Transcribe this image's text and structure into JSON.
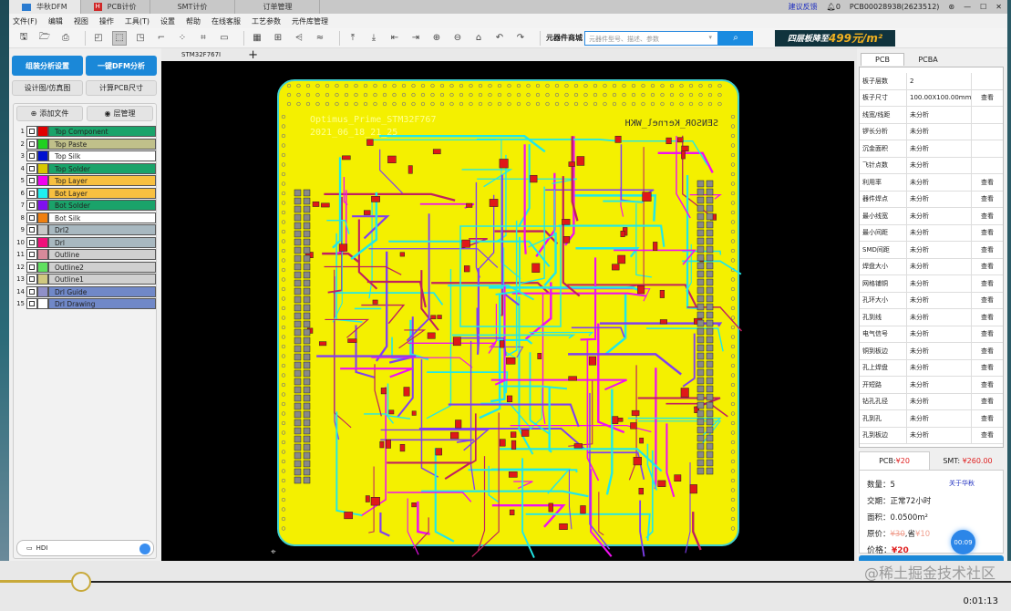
{
  "window": {
    "tabs": [
      {
        "label": "华秋DFM",
        "icon": "app-icon"
      },
      {
        "label": "PCB计价",
        "icon": "h-icon"
      },
      {
        "label": "SMT计价"
      },
      {
        "label": "订单管理"
      }
    ],
    "feedback": "建议反馈",
    "notifications": "0",
    "account": "PCB00028938(2623512)"
  },
  "menu": [
    "文件(F)",
    "编辑",
    "视图",
    "操作",
    "工具(T)",
    "设置",
    "帮助",
    "在线客服",
    "工艺参数",
    "元件库管理"
  ],
  "toolbar": {
    "icons": [
      "save-icon",
      "open-icon",
      "print-icon",
      "|",
      "window-icon",
      "select-icon",
      "zoom-box-icon",
      "route-icon",
      "nodes-icon",
      "net-icon",
      "line-icon",
      "|",
      "grid-icon",
      "align-icon",
      "measure-icon",
      "wave-icon",
      "|",
      "top-align-icon",
      "bottom-align-icon",
      "left-align-icon",
      "right-align-icon",
      "zoom-in-icon",
      "zoom-out-icon",
      "home-icon",
      "undo-icon",
      "redo-icon"
    ],
    "shop_label": "元器件商城",
    "search_placeholder": "元器件型号、描述、参数",
    "banner_text": "四层板降至",
    "banner_price": "499元/m²"
  },
  "file_tab": "STM32F767I",
  "left": {
    "btn_assembly": "组装分析设置",
    "btn_dfm": "一键DFM分析",
    "btn_design": "设计图/仿真图",
    "btn_calc": "计算PCB尺寸",
    "btn_add": "添加文件",
    "btn_layers": "层管理",
    "layers": [
      {
        "n": "1",
        "name": "Top Component",
        "swatch": "#e00000",
        "bg": "#1aa36a"
      },
      {
        "n": "2",
        "name": "Top Paste",
        "swatch": "#20d020",
        "bg": "#c0c08a"
      },
      {
        "n": "3",
        "name": "Top Silk",
        "swatch": "#0010d0",
        "bg": "#ffffff"
      },
      {
        "n": "4",
        "name": "Top Solder",
        "swatch": "#d8c800",
        "bg": "#1aa36a"
      },
      {
        "n": "5",
        "name": "Top Layer",
        "swatch": "#f000f0",
        "bg": "#f8c040"
      },
      {
        "n": "6",
        "name": "Bot Layer",
        "swatch": "#20f0f0",
        "bg": "#f8c040"
      },
      {
        "n": "7",
        "name": "Bot Solder",
        "swatch": "#8010f0",
        "bg": "#1aa36a"
      },
      {
        "n": "8",
        "name": "Bot Silk",
        "swatch": "#f08010",
        "bg": "#ffffff"
      },
      {
        "n": "9",
        "name": "Drl2",
        "swatch": "#c8c8c8",
        "bg": "#a8b8c0"
      },
      {
        "n": "10",
        "name": "Drl",
        "swatch": "#f0107a",
        "bg": "#a8b8c0"
      },
      {
        "n": "11",
        "name": "Outline",
        "swatch": "#d88a9a",
        "bg": "#d0d0d0"
      },
      {
        "n": "12",
        "name": "Outline2",
        "swatch": "#60e060",
        "bg": "#d0d0d0"
      },
      {
        "n": "13",
        "name": "Outline1",
        "swatch": "#d0c880",
        "bg": "#d0d0d0"
      },
      {
        "n": "14",
        "name": "Drl Guide",
        "swatch": "#9090c8",
        "bg": "#7088c8"
      },
      {
        "n": "15",
        "name": "Drl Drawing",
        "swatch": "#ffffff",
        "bg": "#7088c8"
      }
    ],
    "hdi_label": "HDI"
  },
  "board": {
    "text1": "Optimus_Prime_STM32F767",
    "text2": "2021_06_18_21_25",
    "text3": "SENSOR_Kernel_WKH"
  },
  "right": {
    "tabs": [
      "PCB",
      "PCBA"
    ],
    "rows": [
      {
        "k": "板子层数",
        "v": "2",
        "a": ""
      },
      {
        "k": "板子尺寸",
        "v": "100.00X100.00mm",
        "a": "查看"
      },
      {
        "k": "线宽/线距",
        "v": "未分析",
        "a": ""
      },
      {
        "k": "锣长分析",
        "v": "未分析",
        "a": ""
      },
      {
        "k": "沉金面积",
        "v": "未分析",
        "a": ""
      },
      {
        "k": "飞针点数",
        "v": "未分析",
        "a": ""
      },
      {
        "k": "利用率",
        "v": "未分析",
        "a": "查看"
      },
      {
        "k": "器件焊点",
        "v": "未分析",
        "a": "查看"
      },
      {
        "k": "最小线宽",
        "v": "未分析",
        "a": "查看"
      },
      {
        "k": "最小间距",
        "v": "未分析",
        "a": "查看"
      },
      {
        "k": "SMD间距",
        "v": "未分析",
        "a": "查看"
      },
      {
        "k": "焊盘大小",
        "v": "未分析",
        "a": "查看"
      },
      {
        "k": "网格铺铜",
        "v": "未分析",
        "a": "查看"
      },
      {
        "k": "孔环大小",
        "v": "未分析",
        "a": "查看"
      },
      {
        "k": "孔到线",
        "v": "未分析",
        "a": "查看"
      },
      {
        "k": "电气信号",
        "v": "未分析",
        "a": "查看"
      },
      {
        "k": "铜到板边",
        "v": "未分析",
        "a": "查看"
      },
      {
        "k": "孔上焊盘",
        "v": "未分析",
        "a": "查看"
      },
      {
        "k": "开短路",
        "v": "未分析",
        "a": "查看"
      },
      {
        "k": "钻孔孔径",
        "v": "未分析",
        "a": "查看"
      },
      {
        "k": "孔到孔",
        "v": "未分析",
        "a": "查看"
      },
      {
        "k": "孔到板边",
        "v": "未分析",
        "a": "查看"
      }
    ],
    "price": {
      "tab_pcb": "PCB:",
      "tab_pcb_val": "¥20",
      "tab_smt": "SMT:",
      "tab_smt_val": "¥260.00",
      "qty_label": "数量：",
      "qty": "5",
      "about": "关于华秋",
      "lead_label": "交期：",
      "lead": "正常72小时",
      "area_label": "面积：",
      "area": "0.0500m²",
      "orig_label": "原价：",
      "orig": "¥30",
      "save_label": ",省",
      "save": "¥10",
      "price_label": "价格：",
      "price": "¥20",
      "timer": "00:09"
    }
  },
  "video": {
    "progress_percent": 8,
    "time": "0:01:13",
    "watermark": "@稀土掘金技术社区"
  }
}
